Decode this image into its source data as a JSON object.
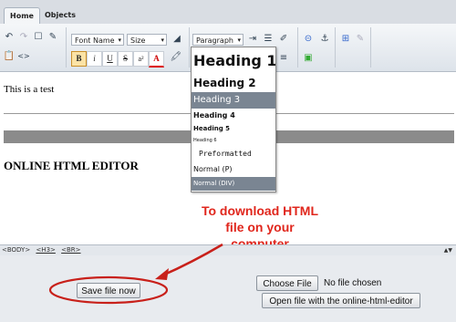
{
  "tabs": [
    {
      "label": "Home"
    },
    {
      "label": "Objects"
    }
  ],
  "toolbar": {
    "font_name": "Font Name",
    "size": "Size",
    "paragraph": "Paragraph",
    "bold_label": "B",
    "italic_label": "i",
    "underline_label": "U",
    "strike_label": "S",
    "superscript_label": "a²",
    "font_color_label": "A",
    "code_label": "<>"
  },
  "editor": {
    "text": "This is a test",
    "heading": "ONLINE HTML EDITOR"
  },
  "format_menu": {
    "items": [
      "Heading 1",
      "Heading 2",
      "Heading 3",
      "Heading 4",
      "Heading 5",
      "Heading 6",
      "Preformatted",
      "Normal (P)",
      "Normal (DIV)"
    ],
    "selected": "Heading 3"
  },
  "annotation": {
    "line1": "To download HTML",
    "line2": "file on your",
    "line3": "computer"
  },
  "statusbar": {
    "tags": [
      "<BODY>",
      "<H3>",
      "<BR>"
    ]
  },
  "actions": {
    "save_label": "Save file now",
    "choose_file_label": "Choose File",
    "no_file_text": "No file chosen",
    "open_label": "Open file with the online-html-editor"
  },
  "colors": {
    "annotation": "#e0261c",
    "menu_selected": "#7a8592"
  }
}
